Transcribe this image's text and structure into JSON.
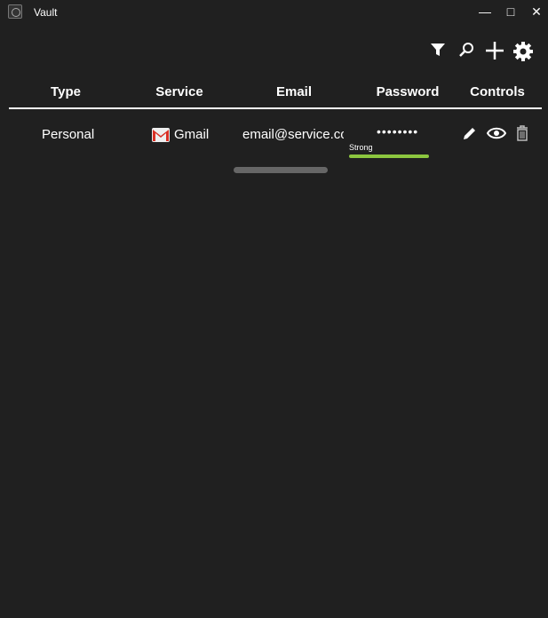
{
  "window": {
    "title": "Vault"
  },
  "table": {
    "headers": [
      "Type",
      "Service",
      "Email",
      "Password",
      "Controls"
    ],
    "rows": [
      {
        "type": "Personal",
        "service": "Gmail",
        "email": "email@service.com",
        "password": "••••••••",
        "strength": "Strong"
      }
    ]
  },
  "colors": {
    "strength": "#8cc63f",
    "background": "#202020"
  }
}
